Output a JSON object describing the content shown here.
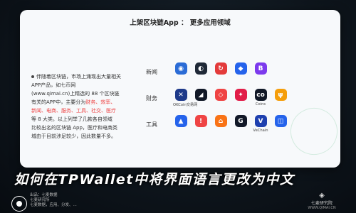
{
  "card": {
    "header": "上架区块链App ： 更多应用领域",
    "text_lines": [
      "伴随着区块链，市场上涌现出大量相关",
      "APP产品，如七币网",
      "(www.qimai.cn)上精选的 88 个区块链",
      "有关的APP中，主要分为",
      "新闻、电商、服务、工具、社交、医疗",
      "等 8 大类。以上列举了几款各自领域",
      "比较出名的区块链 App，医疗和电商类",
      "城由于目前涉足较少，因此数量不多。"
    ],
    "highlight_tail": "财务、效率、",
    "rows": [
      {
        "label": "新闻",
        "apps": [
          {
            "icon": "news-icon-1",
            "color": "#2b6cd6",
            "glyph": "◉",
            "label": ""
          },
          {
            "icon": "news-icon-2",
            "color": "#1f2937",
            "glyph": "◐",
            "label": ""
          },
          {
            "icon": "news-icon-3",
            "color": "#e33b3b",
            "glyph": "↻",
            "label": ""
          },
          {
            "icon": "news-icon-4",
            "color": "#2563eb",
            "glyph": "◆",
            "label": ""
          },
          {
            "icon": "news-icon-5",
            "color": "#7c3aed",
            "glyph": "B",
            "label": ""
          }
        ]
      },
      {
        "label": "财务",
        "apps": [
          {
            "icon": "okcoin-icon",
            "color": "#1e3a8a",
            "glyph": "✕",
            "label": "OKCoin交易网"
          },
          {
            "icon": "finance-icon-2",
            "color": "#111827",
            "glyph": "◢",
            "label": ""
          },
          {
            "icon": "finance-icon-3",
            "color": "#ef4444",
            "glyph": "◇",
            "label": ""
          },
          {
            "icon": "finance-icon-4",
            "color": "#e11d48",
            "glyph": "✦",
            "label": ""
          },
          {
            "icon": "coins-icon",
            "color": "#111827",
            "glyph": "co",
            "label": "Coins"
          },
          {
            "icon": "finance-icon-6",
            "color": "#f59e0b",
            "glyph": "ψ",
            "label": ""
          }
        ]
      },
      {
        "label": "工具",
        "apps": [
          {
            "icon": "tool-icon-1",
            "color": "#2563eb",
            "glyph": "▲",
            "label": ""
          },
          {
            "icon": "tool-icon-2",
            "color": "#ef4444",
            "glyph": "!",
            "label": ""
          },
          {
            "icon": "tool-icon-3",
            "color": "#f97316",
            "glyph": "⌂",
            "label": ""
          },
          {
            "icon": "tool-icon-4",
            "color": "#111827",
            "glyph": "G",
            "label": ""
          },
          {
            "icon": "vechain-icon",
            "color": "#1e40af",
            "glyph": "V",
            "label": "VeChain"
          },
          {
            "icon": "tool-icon-6",
            "color": "#2563eb",
            "glyph": "◫",
            "label": ""
          }
        ]
      }
    ]
  },
  "title": "如何在TPWallet中将界面语言更改为中文",
  "footer": {
    "lines": [
      "出品：七麦数据",
      "七麦研究所",
      "七麦数据，应用、分发、..."
    ],
    "watermark_name": "七麦研究院",
    "watermark_url": "WWW.QIMAI.CN"
  }
}
